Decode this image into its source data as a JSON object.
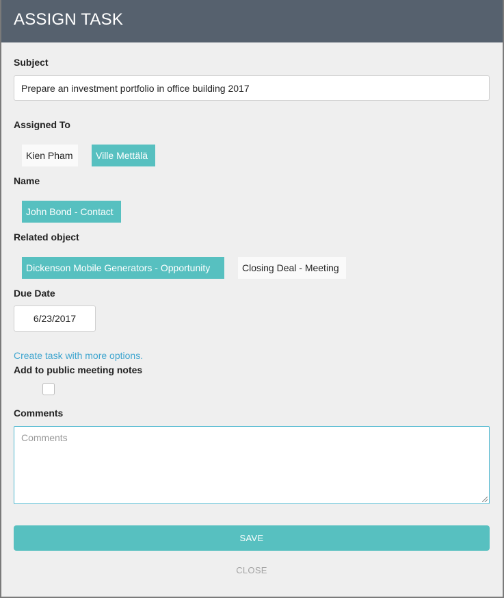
{
  "header": {
    "title": "ASSIGN TASK"
  },
  "subject": {
    "label": "Subject",
    "value": "Prepare an investment portfolio in office building 2017"
  },
  "assigned_to": {
    "label": "Assigned To",
    "chips": [
      {
        "text": "Kien Pham",
        "selected": false
      },
      {
        "text": "Ville Mettälä",
        "selected": true
      }
    ]
  },
  "name": {
    "label": "Name",
    "chips": [
      {
        "text": "John Bond - Contact",
        "selected": true
      }
    ]
  },
  "related_object": {
    "label": "Related object",
    "chips": [
      {
        "text": "Dickenson Mobile Generators - Opportunity",
        "selected": true
      },
      {
        "text": "Closing Deal - Meeting",
        "selected": false
      }
    ]
  },
  "due_date": {
    "label": "Due Date",
    "value": "6/23/2017"
  },
  "more_options_link": "Create task with more options.",
  "public_notes": {
    "label": "Add to public meeting notes",
    "checked": false
  },
  "comments": {
    "label": "Comments",
    "placeholder": "Comments"
  },
  "actions": {
    "save": "SAVE",
    "close": "CLOSE"
  },
  "colors": {
    "header": "#56616e",
    "accent": "#57c0c0",
    "link": "#3ea5cf"
  }
}
